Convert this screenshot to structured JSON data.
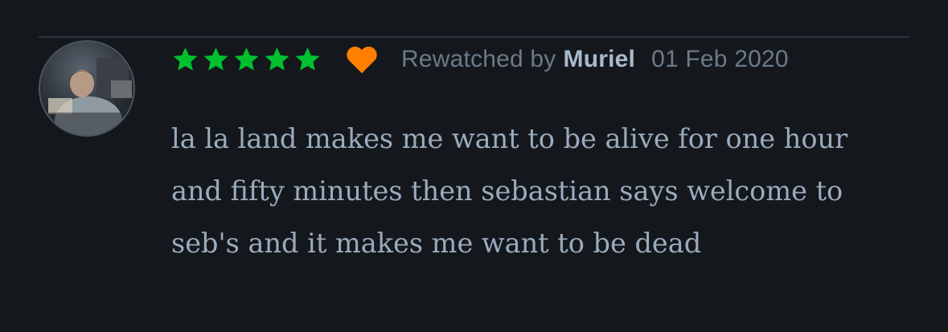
{
  "review": {
    "rating_stars": 5,
    "liked": true,
    "icons": {
      "star": "star-icon",
      "heart": "heart-icon",
      "avatar": "user-avatar"
    },
    "colors": {
      "star": "#00c030",
      "heart": "#ff8000",
      "background": "#14181c",
      "text": "#9aabbe"
    },
    "activity_label": "Rewatched by",
    "username": "Muriel",
    "date": "01 Feb 2020",
    "text": "la la land makes me want to be alive for one hour and fifty minutes then sebastian says welcome to seb's and it makes me want to be dead"
  }
}
